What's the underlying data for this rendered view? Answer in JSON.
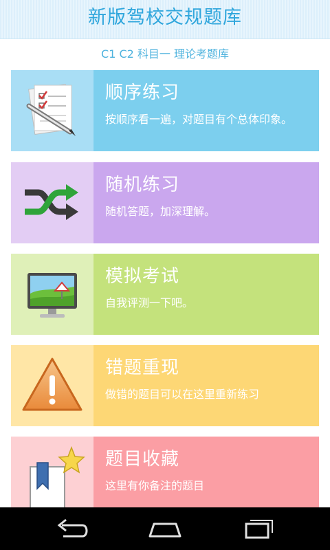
{
  "app": {
    "title": "新版驾校交规题库",
    "subtitle": "C1 C2 科目一 理论考题库"
  },
  "menu": {
    "items": [
      {
        "title": "顺序练习",
        "desc": "按顺序看一遍，对题目有个总体印象。",
        "icon": "checklist-pen-icon"
      },
      {
        "title": "随机练习",
        "desc": "随机答题，加深理解。",
        "icon": "shuffle-icon"
      },
      {
        "title": "模拟考试",
        "desc": "自我评测一下吧。",
        "icon": "monitor-icon"
      },
      {
        "title": "错题重现",
        "desc": "做错的题目可以在这里重新练习",
        "icon": "warning-icon"
      },
      {
        "title": "题目收藏",
        "desc": "这里有你备注的题目",
        "icon": "bookmark-star-icon"
      }
    ]
  },
  "colors": {
    "header_text": "#2fa6dc",
    "card1_icon_bg": "#a9def5",
    "card1_bg": "#7ccfee",
    "card2_icon_bg": "#e3cdf4",
    "card2_bg": "#caa7ee",
    "card3_icon_bg": "#dff0b8",
    "card3_bg": "#c4e27c",
    "card4_icon_bg": "#ffe6a6",
    "card4_bg": "#fdd775",
    "card5_icon_bg": "#fdd0d3",
    "card5_bg": "#fb9ea4"
  },
  "navbar": {
    "icons": [
      "back-icon",
      "home-icon",
      "recent-apps-icon"
    ]
  }
}
